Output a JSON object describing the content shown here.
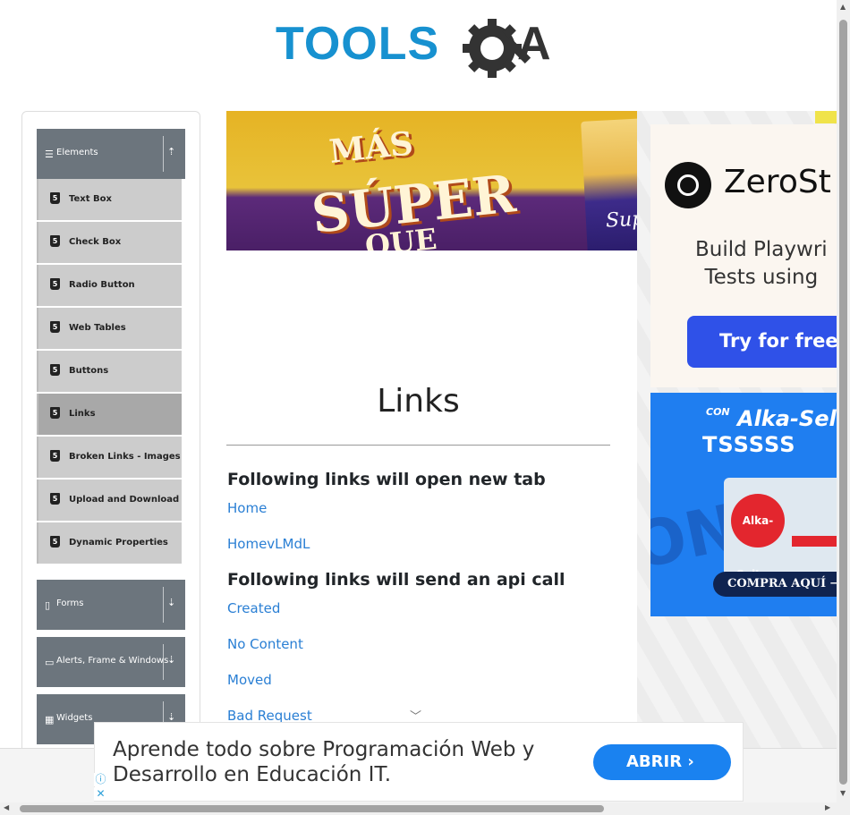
{
  "header": {
    "logo_text_left": "TOOLS",
    "logo_text_right": "A",
    "logo_color_blue": "#1791d0",
    "logo_color_dark": "#333333"
  },
  "sidebar": {
    "groups": [
      {
        "label": "Elements",
        "icon": "list-icon",
        "arrow": "arrow-up-icon"
      },
      {
        "label": "Forms",
        "icon": "document-icon",
        "arrow": "arrow-down-icon"
      },
      {
        "label": "Alerts, Frame & Windows",
        "icon": "window-icon",
        "arrow": "arrow-down-icon"
      },
      {
        "label": "Widgets",
        "icon": "grid-icon",
        "arrow": "arrow-down-icon"
      }
    ],
    "items": [
      {
        "label": "Text Box",
        "icon": "html5-icon"
      },
      {
        "label": "Check Box",
        "icon": "html5-icon"
      },
      {
        "label": "Radio Button",
        "icon": "html5-icon"
      },
      {
        "label": "Web Tables",
        "icon": "html5-icon"
      },
      {
        "label": "Buttons",
        "icon": "html5-icon"
      },
      {
        "label": "Links",
        "icon": "html5-icon",
        "active": true
      },
      {
        "label": "Broken Links - Images",
        "icon": "html5-icon"
      },
      {
        "label": "Upload and Download",
        "icon": "html5-icon"
      },
      {
        "label": "Dynamic Properties",
        "icon": "html5-icon"
      }
    ]
  },
  "ads": {
    "top_banner": {
      "line1": "MÁS",
      "line2": "SÚPER",
      "line3": "QUE",
      "product": "Sup"
    },
    "zero": {
      "name": "ZeroSt",
      "desc_line1": "Build Playwri",
      "desc_line2": "Tests using",
      "button": "Try for free →"
    },
    "alka": {
      "line1": "CON",
      "line2": "Alka-Seltz",
      "line3": "TSSSSS",
      "logo": "Alka-Seltzer",
      "cta": "COMPRA AQUÍ →"
    },
    "bottom": {
      "text": "Aprende todo sobre Programación Web y Desarrollo en Educación IT.",
      "button": "ABRIR",
      "button_color": "#1a82f0"
    }
  },
  "main": {
    "title": "Links",
    "section_new_tab": "Following links will open new tab",
    "new_tab_links": [
      "Home",
      "HomevLMdL"
    ],
    "section_api": "Following links will send an api call",
    "api_links": [
      "Created",
      "No Content",
      "Moved",
      "Bad Request"
    ],
    "link_color": "#2a7fd4"
  }
}
